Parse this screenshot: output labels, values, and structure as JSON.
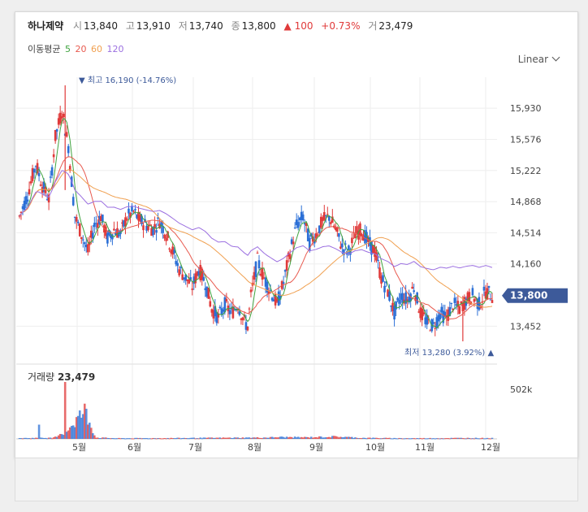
{
  "header": {
    "name": "하나제약",
    "open_label": "시",
    "open": "13,840",
    "high_label": "고",
    "high": "13,910",
    "low_label": "저",
    "low": "13,740",
    "close_label": "종",
    "close": "13,800",
    "change_arrow": "▲",
    "change": "100",
    "change_pct": "+0.73%",
    "volume_label": "거",
    "volume": "23,479"
  },
  "ma": {
    "label": "이동평균",
    "periods": [
      "5",
      "20",
      "60",
      "120"
    ],
    "colors": [
      "#3fa33f",
      "#e85a4f",
      "#f0a050",
      "#9b6fe0"
    ]
  },
  "scale_select": "Linear",
  "annotations": {
    "high_marker": "▼ 최고 16,190 (-14.76%)",
    "low_marker": "최저 13,280 (3.92%) ▲"
  },
  "price_badge": "13,800",
  "volume_panel": {
    "title": "거래량",
    "value": "23,479",
    "axis_label": "502k"
  },
  "colors": {
    "up": "#e03a3a",
    "down": "#2b6fd6",
    "badge": "#3d5a9a",
    "grid": "#eeeeee"
  },
  "chart_data": {
    "type": "candlestick",
    "y_ticks": [
      15930,
      15576,
      15222,
      14868,
      14514,
      14160,
      13452
    ],
    "ylim": [
      13280,
      16190
    ],
    "x_ticks": [
      "5월",
      "6월",
      "7월",
      "8월",
      "9월",
      "10월",
      "11월",
      "12월"
    ],
    "last_close": 13800,
    "high": {
      "value": 16190,
      "pct": "-14.76%"
    },
    "low": {
      "value": 13280,
      "pct": "3.92%"
    },
    "volume_ylim": [
      0,
      502000
    ],
    "price_path": [
      [
        0,
        14700
      ],
      [
        5,
        14950
      ],
      [
        10,
        15300
      ],
      [
        14,
        15050
      ],
      [
        18,
        14900
      ],
      [
        22,
        15600
      ],
      [
        26,
        15900
      ],
      [
        30,
        15500
      ],
      [
        34,
        14700
      ],
      [
        38,
        14500
      ],
      [
        42,
        14300
      ],
      [
        46,
        14600
      ],
      [
        50,
        14700
      ],
      [
        54,
        14450
      ],
      [
        58,
        14550
      ],
      [
        62,
        14500
      ],
      [
        66,
        14700
      ],
      [
        70,
        14750
      ],
      [
        74,
        14650
      ],
      [
        78,
        14600
      ],
      [
        82,
        14560
      ],
      [
        86,
        14650
      ],
      [
        90,
        14500
      ],
      [
        94,
        14300
      ],
      [
        98,
        14100
      ],
      [
        102,
        14000
      ],
      [
        106,
        13900
      ],
      [
        110,
        14100
      ],
      [
        114,
        13950
      ],
      [
        118,
        13650
      ],
      [
        122,
        13550
      ],
      [
        126,
        13700
      ],
      [
        130,
        13600
      ],
      [
        134,
        13700
      ],
      [
        138,
        13500
      ],
      [
        140,
        13450
      ],
      [
        142,
        13800
      ],
      [
        146,
        14200
      ],
      [
        150,
        14000
      ],
      [
        154,
        13850
      ],
      [
        158,
        13700
      ],
      [
        162,
        13950
      ],
      [
        166,
        14300
      ],
      [
        170,
        14600
      ],
      [
        174,
        14700
      ],
      [
        178,
        14400
      ],
      [
        182,
        14500
      ],
      [
        186,
        14650
      ],
      [
        190,
        14700
      ],
      [
        194,
        14550
      ],
      [
        198,
        14350
      ],
      [
        202,
        14300
      ],
      [
        206,
        14500
      ],
      [
        210,
        14550
      ],
      [
        214,
        14400
      ],
      [
        218,
        14300
      ],
      [
        222,
        14000
      ],
      [
        226,
        13850
      ],
      [
        230,
        13600
      ],
      [
        234,
        13800
      ],
      [
        238,
        13750
      ],
      [
        242,
        13900
      ],
      [
        246,
        13600
      ],
      [
        250,
        13500
      ],
      [
        254,
        13450
      ],
      [
        258,
        13600
      ],
      [
        262,
        13550
      ],
      [
        266,
        13700
      ],
      [
        270,
        13650
      ],
      [
        274,
        13750
      ],
      [
        278,
        13800
      ],
      [
        282,
        13700
      ],
      [
        286,
        13850
      ],
      [
        290,
        13800
      ]
    ],
    "volume_profile": [
      [
        0,
        6
      ],
      [
        20,
        8
      ],
      [
        28,
        58
      ],
      [
        40,
        222
      ],
      [
        47,
        10
      ],
      [
        60,
        5
      ],
      [
        90,
        6
      ],
      [
        120,
        8
      ],
      [
        150,
        10
      ],
      [
        160,
        14
      ],
      [
        176,
        12
      ],
      [
        194,
        18
      ],
      [
        210,
        8
      ],
      [
        226,
        6
      ],
      [
        240,
        5
      ],
      [
        260,
        6
      ],
      [
        275,
        7
      ],
      [
        290,
        6
      ]
    ]
  }
}
